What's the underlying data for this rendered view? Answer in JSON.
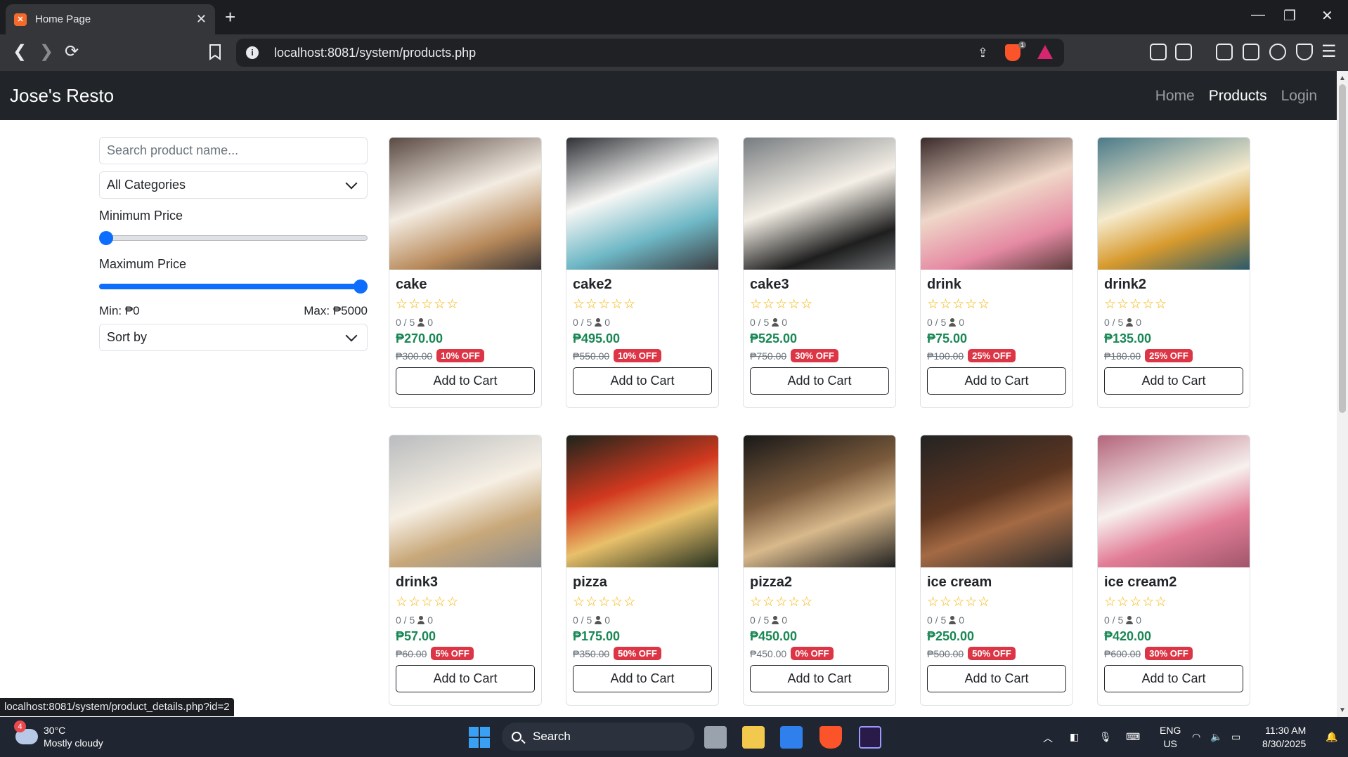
{
  "browser": {
    "tab_title": "Home Page",
    "url": "localhost:8081/system/products.php",
    "shield_badge": "1",
    "status_url": "localhost:8081/system/product_details.php?id=2"
  },
  "site": {
    "brand": "Jose's Resto",
    "nav": [
      "Home",
      "Products",
      "Login"
    ],
    "active_nav": "Products"
  },
  "filters": {
    "search_placeholder": "Search product name...",
    "category": "All Categories",
    "min_label": "Minimum Price",
    "max_label": "Maximum Price",
    "min_value_text": "Min: ₱0",
    "max_value_text": "Max: ₱5000",
    "min_price": 0,
    "max_price": 5000,
    "price_range_max": 5000,
    "sort": "Sort by"
  },
  "products": [
    {
      "name": "cake",
      "stars": "☆☆☆☆☆",
      "rating": "0 / 5",
      "count": "0",
      "price": "₱270.00",
      "old": "₱300.00",
      "discount": "10% OFF",
      "button": "Add to Cart"
    },
    {
      "name": "cake2",
      "stars": "☆☆☆☆☆",
      "rating": "0 / 5",
      "count": "0",
      "price": "₱495.00",
      "old": "₱550.00",
      "discount": "10% OFF",
      "button": "Add to Cart"
    },
    {
      "name": "cake3",
      "stars": "☆☆☆☆☆",
      "rating": "0 / 5",
      "count": "0",
      "price": "₱525.00",
      "old": "₱750.00",
      "discount": "30% OFF",
      "button": "Add to Cart"
    },
    {
      "name": "drink",
      "stars": "☆☆☆☆☆",
      "rating": "0 / 5",
      "count": "0",
      "price": "₱75.00",
      "old": "₱100.00",
      "discount": "25% OFF",
      "button": "Add to Cart"
    },
    {
      "name": "drink2",
      "stars": "☆☆☆☆☆",
      "rating": "0 / 5",
      "count": "0",
      "price": "₱135.00",
      "old": "₱180.00",
      "discount": "25% OFF",
      "button": "Add to Cart"
    },
    {
      "name": "drink3",
      "stars": "☆☆☆☆☆",
      "rating": "0 / 5",
      "count": "0",
      "price": "₱57.00",
      "old": "₱60.00",
      "discount": "5% OFF",
      "button": "Add to Cart"
    },
    {
      "name": "pizza",
      "stars": "☆☆☆☆☆",
      "rating": "0 / 5",
      "count": "0",
      "price": "₱175.00",
      "old": "₱350.00",
      "discount": "50% OFF",
      "button": "Add to Cart"
    },
    {
      "name": "pizza2",
      "stars": "☆☆☆☆☆",
      "rating": "0 / 5",
      "count": "0",
      "price": "₱450.00",
      "old": "₱450.00",
      "discount": "0% OFF",
      "button": "Add to Cart"
    },
    {
      "name": "ice cream",
      "stars": "☆☆☆☆☆",
      "rating": "0 / 5",
      "count": "0",
      "price": "₱250.00",
      "old": "₱500.00",
      "discount": "50% OFF",
      "button": "Add to Cart"
    },
    {
      "name": "ice cream2",
      "stars": "☆☆☆☆☆",
      "rating": "0 / 5",
      "count": "0",
      "price": "₱420.00",
      "old": "₱600.00",
      "discount": "30% OFF",
      "button": "Add to Cart"
    }
  ],
  "taskbar": {
    "weather_badge": "4",
    "temperature": "30°C",
    "condition": "Mostly cloudy",
    "search_label": "Search",
    "lang": "ENG",
    "region": "US",
    "time": "11:30 AM",
    "date": "8/30/2025"
  },
  "colors": {
    "accent": "#0d6efd",
    "price_green": "#198754",
    "discount_red": "#dc3545",
    "navbar": "#212529"
  }
}
